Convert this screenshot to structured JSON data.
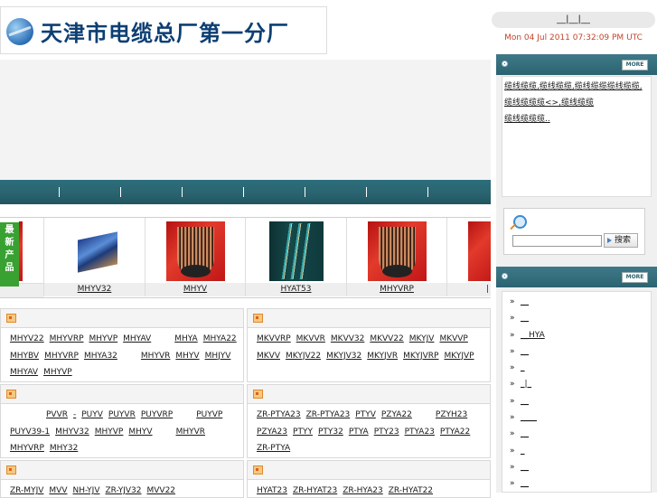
{
  "header": {
    "logo_text": "天津市电缆总厂第一分厂",
    "top_links": "__|__|__",
    "datetime": "Mon 04 Jul 2011 07:32:09 PM UTC"
  },
  "products": {
    "side_label": [
      "最",
      "新",
      "产",
      "品"
    ],
    "items": [
      {
        "label": "MHYV32",
        "image": "cable-blue"
      },
      {
        "label": "MHYV",
        "image": "cable-red"
      },
      {
        "label": "HYAT53",
        "image": "cable-teal"
      },
      {
        "label": "MHYVRP",
        "image": "cable-red"
      }
    ],
    "partial_label": "|"
  },
  "categories": {
    "left": [
      {
        "links": [
          "MHYV22",
          "MHYVRP",
          "MHYVP",
          "MHYAV",
          "",
          "MHYA",
          "MHYA22",
          "MHYBV",
          "MHYVRP",
          "MHYA32",
          "",
          "MHYVR",
          "MHYV",
          "MHJYV",
          "MHYAV",
          "MHYVP"
        ]
      },
      {
        "links": [
          "",
          "",
          "PVVR",
          "-",
          "PUYV",
          "PUYVR",
          "PUYVRP",
          "",
          "PUYVP",
          "PUYV39-1",
          "MHYV32",
          "MHYVP",
          "MHYV",
          "",
          "MHYVR",
          "MHYVRP",
          "MHY32"
        ]
      },
      {
        "links": [
          "ZR-MYJV",
          "MVV",
          "NH-YJV",
          "ZR-YJV32",
          "MVV22"
        ]
      }
    ],
    "right": [
      {
        "links": [
          "MKVVRP",
          "MKVVR",
          "MKVV32",
          "MKVV22",
          "MKYJV",
          "MKVVP",
          "MKVV",
          "MKYJV22",
          "MKYJV32",
          "MKYJVR",
          "MKYJVRP",
          "MKYJVP"
        ]
      },
      {
        "links": [
          "ZR-PTYA23",
          "ZR-PTYA23",
          "PTYV",
          "PZYA22",
          "",
          "PZYH23",
          "PZYA23",
          "PTYY",
          "PTY32",
          "PTYA",
          "PTY23",
          "PTYA23",
          "PTYA22",
          "ZR-PTYA"
        ]
      },
      {
        "links": [
          "HYAT23",
          "ZR-HYAT23",
          "ZR-HYA23",
          "ZR-HYAT22"
        ]
      }
    ]
  },
  "sidebar": {
    "more_label": "MORE",
    "notice_text": [
      "缆线缆缆,缆线缆缆,缆线缆缆缆线缆缆,缆线缆缆缆<>,缆线缆缆",
      "缆线缆缆缆.."
    ],
    "search_placeholder": "",
    "search_button": "搜索",
    "links": [
      "__",
      "__",
      "__HYA",
      "__",
      "_",
      "_|_",
      "__",
      "____",
      "__",
      "_",
      "__",
      "__"
    ]
  },
  "colors": {
    "nav_teal": "#2a6470",
    "product_label_green": "#39a132",
    "date_red": "#c2452d",
    "logo_blue": "#0d3f73"
  }
}
